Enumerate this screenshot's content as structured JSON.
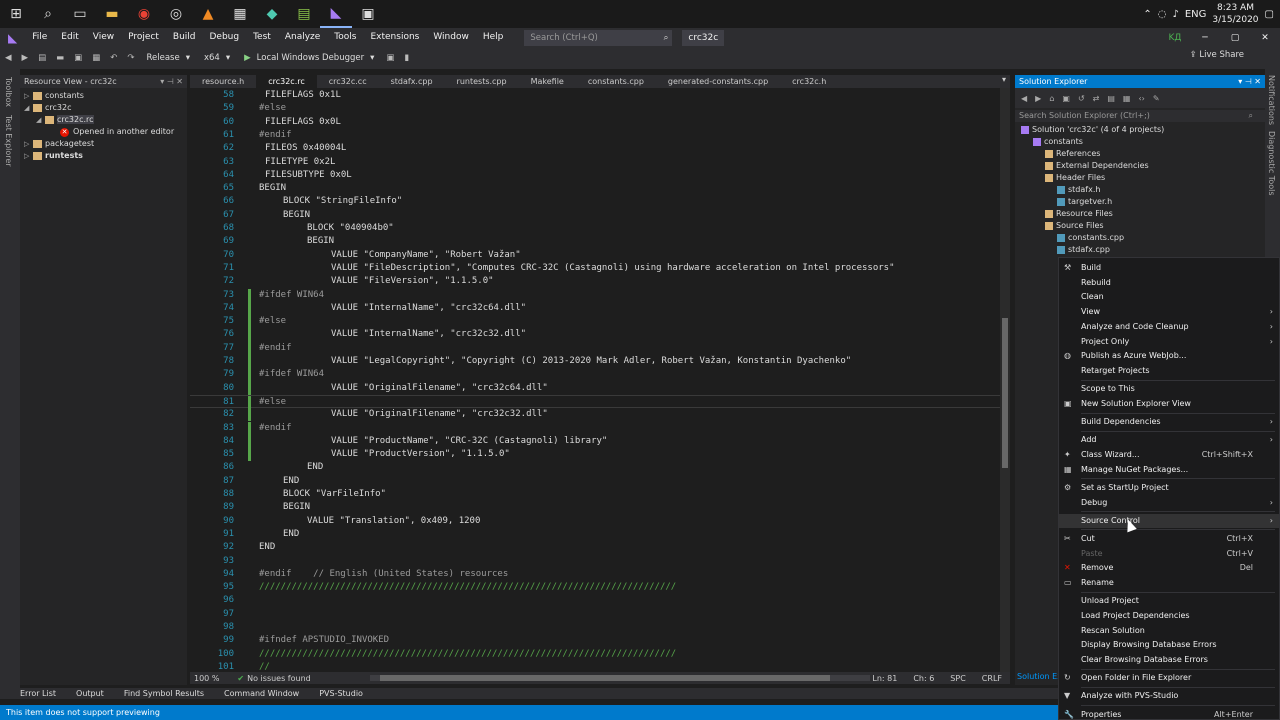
{
  "taskbar": {
    "clock_time": "8:23 AM",
    "clock_date": "3/15/2020",
    "lang": "ENG"
  },
  "menubar": {
    "items": [
      "File",
      "Edit",
      "View",
      "Project",
      "Build",
      "Debug",
      "Test",
      "Analyze",
      "Tools",
      "Extensions",
      "Window",
      "Help"
    ],
    "search_placeholder": "Search (Ctrl+Q)",
    "solution_name": "crc32c",
    "user_initials": "KД"
  },
  "toolbar": {
    "config": "Release",
    "platform": "x64",
    "debugger": "Local Windows Debugger",
    "live_share": "Live Share"
  },
  "left_strip": {
    "toolbox": "Toolbox",
    "test_explorer": "Test Explorer"
  },
  "resource_view": {
    "title": "Resource View - crc32c",
    "rows": [
      {
        "label": "constants"
      },
      {
        "label": "crc32c"
      },
      {
        "label": "crc32c.rc"
      },
      {
        "label": "Opened in another editor"
      },
      {
        "label": "packagetest"
      },
      {
        "label": "runtests"
      }
    ]
  },
  "tabs": [
    "resource.h",
    "crc32c.rc",
    "crc32c.cc",
    "stdafx.cpp",
    "runtests.cpp",
    "Makefile",
    "constants.cpp",
    "generated-constants.cpp",
    "crc32c.h"
  ],
  "editor": {
    "lines": [
      {
        "n": "58",
        "t": "FILEFLAGS 0x1L",
        "ind": 1
      },
      {
        "n": "59",
        "t": "#else",
        "ind": 0
      },
      {
        "n": "60",
        "t": "FILEFLAGS 0x0L",
        "ind": 1
      },
      {
        "n": "61",
        "t": "#endif",
        "ind": 0
      },
      {
        "n": "62",
        "t": "FILEOS 0x40004L",
        "ind": 1
      },
      {
        "n": "63",
        "t": "FILETYPE 0x2L",
        "ind": 1
      },
      {
        "n": "64",
        "t": "FILESUBTYPE 0x0L",
        "ind": 1
      },
      {
        "n": "65",
        "t": "BEGIN",
        "ind": 0
      },
      {
        "n": "66",
        "t": "BLOCK \"StringFileInfo\"",
        "ind": 4
      },
      {
        "n": "67",
        "t": "BEGIN",
        "ind": 4
      },
      {
        "n": "68",
        "t": "BLOCK \"040904b0\"",
        "ind": 8
      },
      {
        "n": "69",
        "t": "BEGIN",
        "ind": 8
      },
      {
        "n": "70",
        "t": "VALUE \"CompanyName\", \"Robert Važan\"",
        "ind": 12
      },
      {
        "n": "71",
        "t": "VALUE \"FileDescription\", \"Computes CRC-32C (Castagnoli) using hardware acceleration on Intel processors\"",
        "ind": 12
      },
      {
        "n": "72",
        "t": "VALUE \"FileVersion\", \"1.1.5.0\"",
        "ind": 12
      },
      {
        "n": "73",
        "t": "#ifdef WIN64",
        "ind": 0
      },
      {
        "n": "74",
        "t": "VALUE \"InternalName\", \"crc32c64.dll\"",
        "ind": 12
      },
      {
        "n": "75",
        "t": "#else",
        "ind": 0
      },
      {
        "n": "76",
        "t": "VALUE \"InternalName\", \"crc32c32.dll\"",
        "ind": 12
      },
      {
        "n": "77",
        "t": "#endif",
        "ind": 0
      },
      {
        "n": "78",
        "t": "VALUE \"LegalCopyright\", \"Copyright (C) 2013-2020 Mark Adler, Robert Važan, Konstantin Dyachenko\"",
        "ind": 12
      },
      {
        "n": "79",
        "t": "#ifdef WIN64",
        "ind": 0
      },
      {
        "n": "80",
        "t": "VALUE \"OriginalFilename\", \"crc32c64.dll\"",
        "ind": 12
      },
      {
        "n": "81",
        "t": "#else",
        "ind": 0
      },
      {
        "n": "82",
        "t": "VALUE \"OriginalFilename\", \"crc32c32.dll\"",
        "ind": 12
      },
      {
        "n": "83",
        "t": "#endif",
        "ind": 0
      },
      {
        "n": "84",
        "t": "VALUE \"ProductName\", \"CRC-32C (Castagnoli) library\"",
        "ind": 12
      },
      {
        "n": "85",
        "t": "VALUE \"ProductVersion\", \"1.1.5.0\"",
        "ind": 12
      },
      {
        "n": "86",
        "t": "END",
        "ind": 8
      },
      {
        "n": "87",
        "t": "END",
        "ind": 4
      },
      {
        "n": "88",
        "t": "BLOCK \"VarFileInfo\"",
        "ind": 4
      },
      {
        "n": "89",
        "t": "BEGIN",
        "ind": 4
      },
      {
        "n": "90",
        "t": "VALUE \"Translation\", 0x409, 1200",
        "ind": 8
      },
      {
        "n": "91",
        "t": "END",
        "ind": 4
      },
      {
        "n": "92",
        "t": "END",
        "ind": 0
      },
      {
        "n": "93",
        "t": "",
        "ind": 0
      },
      {
        "n": "94",
        "t": "#endif    // English (United States) resources",
        "ind": 0
      },
      {
        "n": "95",
        "t": "/////////////////////////////////////////////////////////////////////////////",
        "ind": 0
      },
      {
        "n": "96",
        "t": "",
        "ind": 0
      },
      {
        "n": "97",
        "t": "",
        "ind": 0
      },
      {
        "n": "98",
        "t": "",
        "ind": 0
      },
      {
        "n": "99",
        "t": "#ifndef APSTUDIO_INVOKED",
        "ind": 0
      },
      {
        "n": "100",
        "t": "/////////////////////////////////////////////////////////////////////////////",
        "ind": 0
      },
      {
        "n": "101",
        "t": "//",
        "ind": 0
      }
    ]
  },
  "editor_status": {
    "zoom": "100 %",
    "issues": "No issues found",
    "ln": "Ln: 81",
    "ch": "Ch: 6",
    "spc": "SPC",
    "crlf": "CRLF"
  },
  "bottom_tabs": [
    "Error List",
    "Output",
    "Find Symbol Results",
    "Command Window",
    "PVS-Studio"
  ],
  "statusbar": {
    "message": "This item does not support previewing"
  },
  "solution_explorer": {
    "title": "Solution Explorer",
    "search_placeholder": "Search Solution Explorer (Ctrl+;)",
    "rows": [
      {
        "label": "Solution 'crc32c' (4 of 4 projects)",
        "ind": 0
      },
      {
        "label": "constants",
        "ind": 1
      },
      {
        "label": "References",
        "ind": 2
      },
      {
        "label": "External Dependencies",
        "ind": 2
      },
      {
        "label": "Header Files",
        "ind": 2
      },
      {
        "label": "stdafx.h",
        "ind": 3
      },
      {
        "label": "targetver.h",
        "ind": 3
      },
      {
        "label": "Resource Files",
        "ind": 2
      },
      {
        "label": "Source Files",
        "ind": 2
      },
      {
        "label": "constants.cpp",
        "ind": 3
      },
      {
        "label": "stdafx.cpp",
        "ind": 3
      }
    ],
    "bottom_tab": "Solution Ex"
  },
  "right_strip": {
    "notifications": "Notifications",
    "diag": "Diagnostic Tools"
  },
  "context_menu": {
    "items": [
      {
        "label": "Build",
        "shortcut": "",
        "sub": false,
        "icon": "build-icon",
        "sep_after": false,
        "disabled": false
      },
      {
        "label": "Rebuild",
        "shortcut": "",
        "sub": false,
        "icon": "",
        "sep_after": false,
        "disabled": false
      },
      {
        "label": "Clean",
        "shortcut": "",
        "sub": false,
        "icon": "",
        "sep_after": false,
        "disabled": false
      },
      {
        "label": "View",
        "shortcut": "",
        "sub": true,
        "icon": "",
        "sep_after": false,
        "disabled": false
      },
      {
        "label": "Analyze and Code Cleanup",
        "shortcut": "",
        "sub": true,
        "icon": "",
        "sep_after": false,
        "disabled": false
      },
      {
        "label": "Project Only",
        "shortcut": "",
        "sub": true,
        "icon": "",
        "sep_after": false,
        "disabled": false
      },
      {
        "label": "Publish as Azure WebJob...",
        "shortcut": "",
        "sub": false,
        "icon": "globe-icon",
        "sep_after": false,
        "disabled": false
      },
      {
        "label": "Retarget Projects",
        "shortcut": "",
        "sub": false,
        "icon": "",
        "sep_after": true,
        "disabled": false
      },
      {
        "label": "Scope to This",
        "shortcut": "",
        "sub": false,
        "icon": "",
        "sep_after": false,
        "disabled": false
      },
      {
        "label": "New Solution Explorer View",
        "shortcut": "",
        "sub": false,
        "icon": "window-icon",
        "sep_after": true,
        "disabled": false
      },
      {
        "label": "Build Dependencies",
        "shortcut": "",
        "sub": true,
        "icon": "",
        "sep_after": true,
        "disabled": false
      },
      {
        "label": "Add",
        "shortcut": "",
        "sub": true,
        "icon": "",
        "sep_after": false,
        "disabled": false
      },
      {
        "label": "Class Wizard...",
        "shortcut": "Ctrl+Shift+X",
        "sub": false,
        "icon": "wand-icon",
        "sep_after": false,
        "disabled": false
      },
      {
        "label": "Manage NuGet Packages...",
        "shortcut": "",
        "sub": false,
        "icon": "nuget-icon",
        "sep_after": true,
        "disabled": false
      },
      {
        "label": "Set as StartUp Project",
        "shortcut": "",
        "sub": false,
        "icon": "gear-icon",
        "sep_after": false,
        "disabled": false
      },
      {
        "label": "Debug",
        "shortcut": "",
        "sub": true,
        "icon": "",
        "sep_after": true,
        "disabled": false
      },
      {
        "label": "Source Control",
        "shortcut": "",
        "sub": true,
        "icon": "",
        "sep_after": true,
        "disabled": false
      },
      {
        "label": "Cut",
        "shortcut": "Ctrl+X",
        "sub": false,
        "icon": "scissors-icon",
        "sep_after": false,
        "disabled": false
      },
      {
        "label": "Paste",
        "shortcut": "Ctrl+V",
        "sub": false,
        "icon": "",
        "sep_after": false,
        "disabled": true
      },
      {
        "label": "Remove",
        "shortcut": "Del",
        "sub": false,
        "icon": "close-icon",
        "sep_after": false,
        "disabled": false
      },
      {
        "label": "Rename",
        "shortcut": "",
        "sub": false,
        "icon": "rename-icon",
        "sep_after": true,
        "disabled": false
      },
      {
        "label": "Unload Project",
        "shortcut": "",
        "sub": false,
        "icon": "",
        "sep_after": false,
        "disabled": false
      },
      {
        "label": "Load Project Dependencies",
        "shortcut": "",
        "sub": false,
        "icon": "",
        "sep_after": false,
        "disabled": false
      },
      {
        "label": "Rescan Solution",
        "shortcut": "",
        "sub": false,
        "icon": "",
        "sep_after": false,
        "disabled": false
      },
      {
        "label": "Display Browsing Database Errors",
        "shortcut": "",
        "sub": false,
        "icon": "",
        "sep_after": false,
        "disabled": false
      },
      {
        "label": "Clear Browsing Database Errors",
        "shortcut": "",
        "sub": false,
        "icon": "",
        "sep_after": true,
        "disabled": false
      },
      {
        "label": "Open Folder in File Explorer",
        "shortcut": "",
        "sub": false,
        "icon": "folder-icon",
        "sep_after": true,
        "disabled": false
      },
      {
        "label": "Analyze with PVS-Studio",
        "shortcut": "",
        "sub": false,
        "icon": "pvs-icon",
        "sep_after": true,
        "disabled": false
      },
      {
        "label": "Properties",
        "shortcut": "Alt+Enter",
        "sub": false,
        "icon": "wrench-icon",
        "sep_after": false,
        "disabled": false
      }
    ]
  },
  "colors": {
    "accent": "#007acc",
    "menu_bg": "#1b1b1c",
    "editor_bg": "#1e1e1e"
  }
}
